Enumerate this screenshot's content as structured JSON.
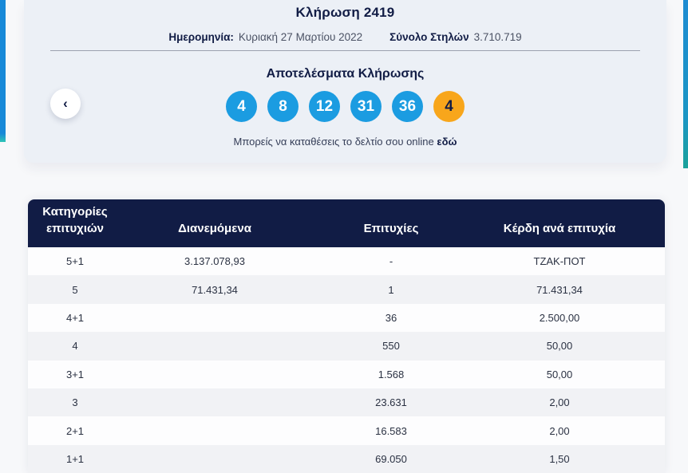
{
  "draw": {
    "title": "Κλήρωση 2419",
    "date_label": "Ημερομηνία:",
    "date_value": "Κυριακή 27 Μαρτίου 2022",
    "total_columns_label": "Σύνολο Στηλών",
    "total_columns_value": "3.710.719",
    "results_title": "Αποτελέσματα Κλήρωσης",
    "numbers": [
      "4",
      "8",
      "12",
      "31",
      "36"
    ],
    "joker_number": "4",
    "online_text": "Μπορείς να καταθέσεις το δελτίο σου online",
    "online_link_label": "εδώ"
  },
  "carousel": {
    "prev_arrow": "‹"
  },
  "table": {
    "headers": [
      "Κατηγορίες επιτυχιών",
      "Διανεμόμενα",
      "Επιτυχίες",
      "Κέρδη ανά επιτυχία"
    ],
    "rows": [
      {
        "category": "5+1",
        "distributed": "3.137.078,93",
        "winners": "-",
        "prize": "ΤΖΑΚ-ΠΟΤ"
      },
      {
        "category": "5",
        "distributed": "71.431,34",
        "winners": "1",
        "prize": "71.431,34"
      },
      {
        "category": "4+1",
        "distributed": "",
        "winners": "36",
        "prize": "2.500,00"
      },
      {
        "category": "4",
        "distributed": "",
        "winners": "550",
        "prize": "50,00"
      },
      {
        "category": "3+1",
        "distributed": "",
        "winners": "1.568",
        "prize": "50,00"
      },
      {
        "category": "3",
        "distributed": "",
        "winners": "23.631",
        "prize": "2,00"
      },
      {
        "category": "2+1",
        "distributed": "",
        "winners": "16.583",
        "prize": "2,00"
      },
      {
        "category": "1+1",
        "distributed": "",
        "winners": "69.050",
        "prize": "1,50"
      }
    ]
  },
  "colors": {
    "ball_blue": "#1B9CE1",
    "joker_orange": "#F8A61B",
    "header_navy": "#111C45",
    "card_background": "#ECF0F6"
  }
}
